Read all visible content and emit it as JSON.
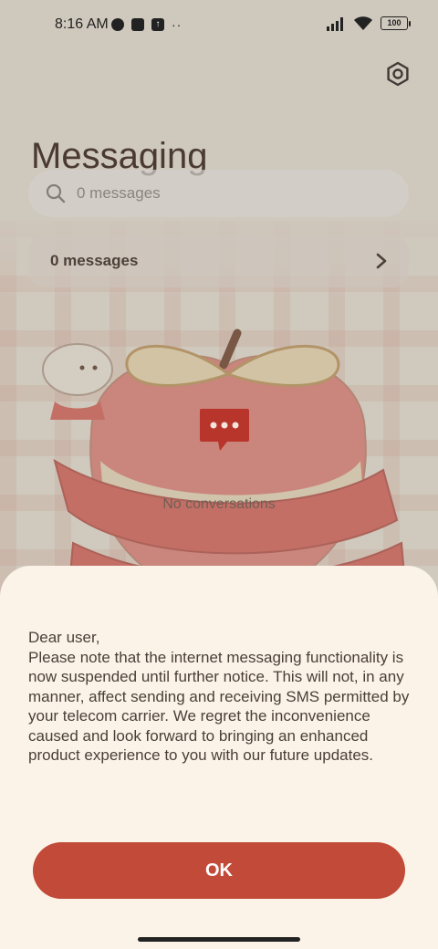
{
  "status_bar": {
    "time": "8:16 AM",
    "left_icons": [
      "vpn-icon",
      "notification-square-icon",
      "upload-icon"
    ],
    "overflow": "··",
    "right_icons": [
      "signal-icon",
      "wifi-icon"
    ],
    "battery": "100"
  },
  "header": {
    "title": "Messaging",
    "settings_icon": "gear-icon"
  },
  "search": {
    "placeholder": "0 messages",
    "icon": "search-icon"
  },
  "summary": {
    "label": "0 messages",
    "icon": "chevron-right-icon"
  },
  "empty_state": {
    "icon": "chat-bubble-icon",
    "text": "No conversations"
  },
  "dialog": {
    "message": "Dear user,\nPlease note that the internet messaging functionality is now suspended until further notice. This will not, in any manner, affect sending and receiving SMS permitted by your telecom carrier. We regret the inconvenience caused and look forward to bringing an enhanced product experience to you with our future updates.",
    "ok_label": "OK"
  },
  "colors": {
    "accent": "#c24a38",
    "sheet_background": "#fbf3e8",
    "title_text": "#4a3a30"
  }
}
